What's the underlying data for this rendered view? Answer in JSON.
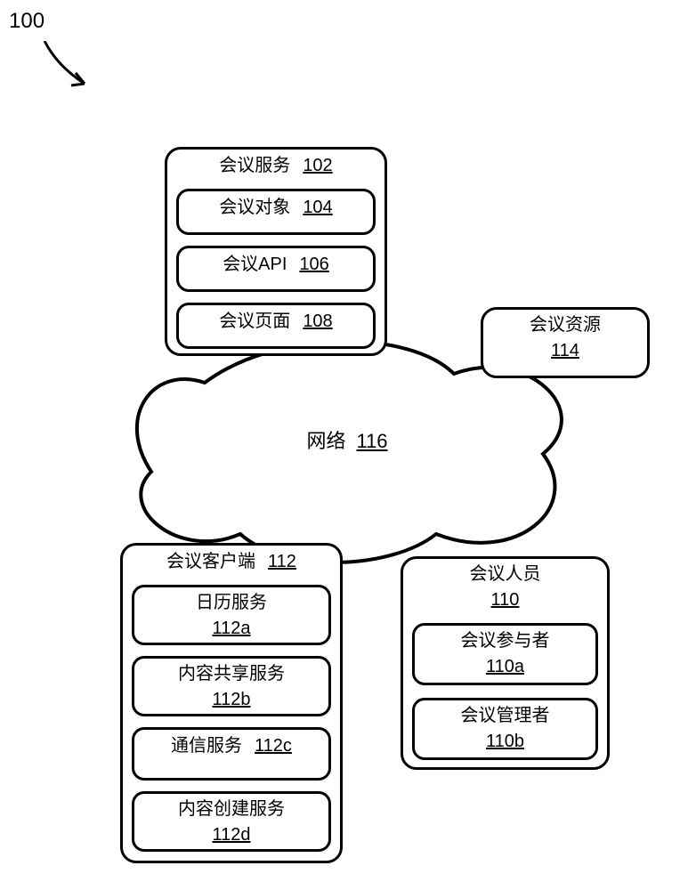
{
  "figure_ref": "100",
  "network": {
    "label": "网络",
    "num": "116"
  },
  "service": {
    "title": "会议服务",
    "num": "102",
    "object": {
      "label": "会议对象",
      "num": "104"
    },
    "api": {
      "label": "会议API",
      "num": "106"
    },
    "page": {
      "label": "会议页面",
      "num": "108"
    }
  },
  "resource": {
    "label": "会议资源",
    "num": "114"
  },
  "client": {
    "title": "会议客户端",
    "num": "112",
    "cal": {
      "label": "日历服务",
      "num": "112a"
    },
    "share": {
      "label": "内容共享服务",
      "num": "112b"
    },
    "comm": {
      "label": "通信服务",
      "num": "112c"
    },
    "create": {
      "label": "内容创建服务",
      "num": "112d"
    }
  },
  "people": {
    "title": "会议人员",
    "num": "110",
    "participant": {
      "label": "会议参与者",
      "num": "110a"
    },
    "manager": {
      "label": "会议管理者",
      "num": "110b"
    }
  }
}
